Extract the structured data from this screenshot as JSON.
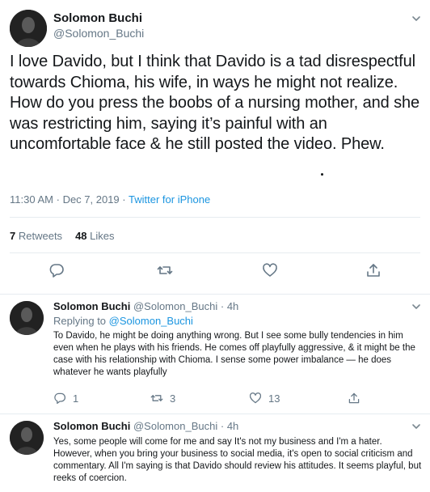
{
  "main_tweet": {
    "author_name": "Solomon Buchi",
    "author_handle": "@Solomon_Buchi",
    "text": "I love Davido, but I think that Davido is a tad disrespectful towards Chioma, his wife, in ways he might not realize. How do you press the boobs of a nursing mother, and she was restricting him, saying it’s painful with an uncomfortable face & he still posted the video. Phew.",
    "time": "11:30 AM",
    "date": "Dec 7, 2019",
    "meta_separator": "·",
    "source": "Twitter for iPhone",
    "retweets_count": "7",
    "retweets_label": "Retweets",
    "likes_count": "48",
    "likes_label": "Likes",
    "icons": [
      "reply-icon",
      "retweet-icon",
      "like-icon",
      "share-icon",
      "chevron-down-icon"
    ]
  },
  "replies": [
    {
      "author_name": "Solomon Buchi",
      "author_handle": "@Solomon_Buchi",
      "time_ago": "4h",
      "replying_prefix": "Replying to",
      "replying_to": "@Solomon_Buchi",
      "text": "To Davido, he might be doing anything wrong. But I see some bully tendencies in him even when he plays with his friends. He comes off playfully aggressive, & it might be the case with his relationship with Chioma. I sense some power imbalance — he does whatever he wants playfully",
      "reply_count": "1",
      "retweet_count": "3",
      "like_count": "13"
    },
    {
      "author_name": "Solomon Buchi",
      "author_handle": "@Solomon_Buchi",
      "time_ago": "4h",
      "text": "Yes, some people will come for me and say It's not my business and I'm a hater. However, when you bring your business to social media, it's open to social criticism and commentary. All I'm saying is that Davido should review his attitudes. It seems playful, but reeks of coercion."
    }
  ],
  "colors": {
    "text": "#14171a",
    "secondary": "#657786",
    "link": "#1b95e0",
    "divider": "#e6ecf0"
  }
}
